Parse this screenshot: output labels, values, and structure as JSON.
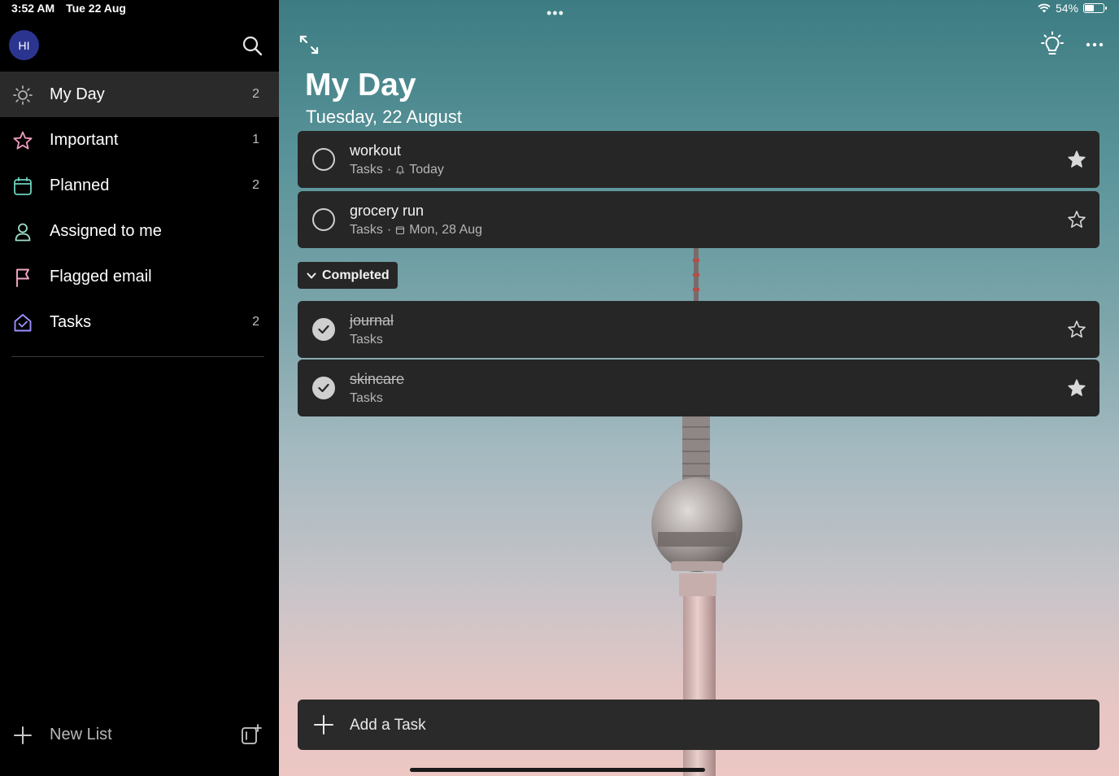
{
  "status": {
    "time": "3:52 AM",
    "date": "Tue 22 Aug",
    "battery": "54%",
    "battery_level": 0.54
  },
  "sidebar": {
    "avatar_initials": "HI",
    "items": [
      {
        "label": "My Day",
        "count": "2",
        "icon": "sun-icon",
        "active": true
      },
      {
        "label": "Important",
        "count": "1",
        "icon": "star-icon"
      },
      {
        "label": "Planned",
        "count": "2",
        "icon": "calendar-icon"
      },
      {
        "label": "Assigned to me",
        "count": "",
        "icon": "person-icon"
      },
      {
        "label": "Flagged email",
        "count": "",
        "icon": "flag-icon"
      },
      {
        "label": "Tasks",
        "count": "2",
        "icon": "home-icon"
      }
    ],
    "new_list_label": "New List"
  },
  "main": {
    "title": "My Day",
    "date": "Tuesday, 22 August",
    "tasks": [
      {
        "title": "workout",
        "list": "Tasks",
        "due": "Today",
        "due_icon": "bell-icon",
        "starred": true,
        "completed": false
      },
      {
        "title": "grocery run",
        "list": "Tasks",
        "due": "Mon, 28 Aug",
        "due_icon": "calendar-icon",
        "starred": false,
        "completed": false
      }
    ],
    "completed_label": "Completed",
    "completed_tasks": [
      {
        "title": "journal",
        "list": "Tasks",
        "starred": false,
        "completed": true
      },
      {
        "title": "skincare",
        "list": "Tasks",
        "starred": true,
        "completed": true
      }
    ],
    "add_task_label": "Add a Task"
  },
  "colors": {
    "accent_my_day": "#b0b0b0",
    "accent_important": "#f09cc0",
    "accent_planned": "#6ed2c0",
    "accent_assigned": "#9ee0c8",
    "accent_flagged": "#f3a7c5",
    "accent_tasks": "#9b90ff"
  }
}
